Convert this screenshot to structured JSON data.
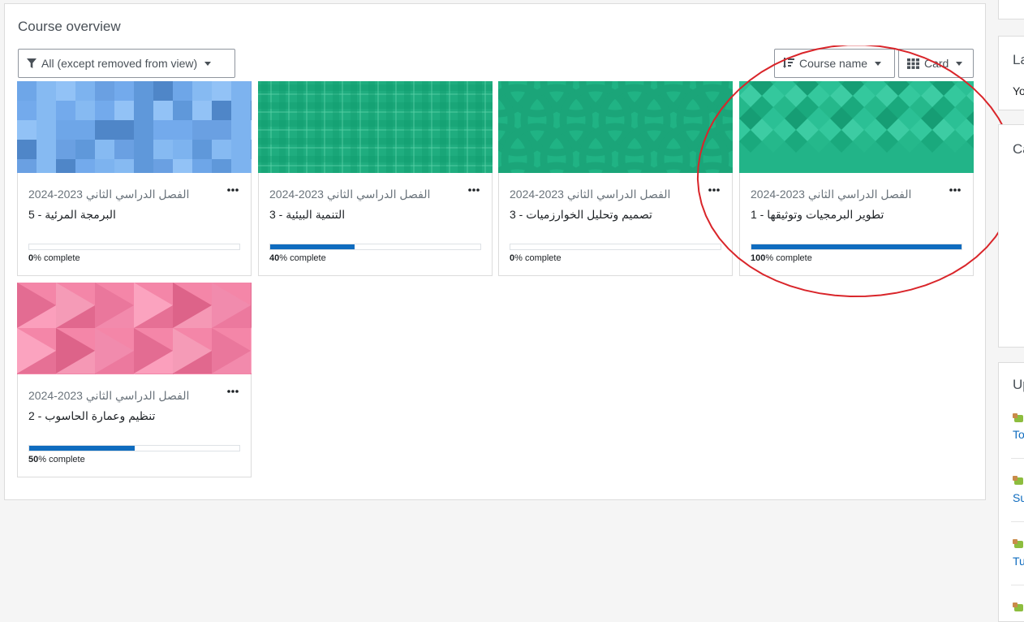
{
  "overview": {
    "title": "Course overview",
    "filter_label": "All (except removed from view)",
    "sort_label": "Course name",
    "view_label": "Card"
  },
  "courses": [
    {
      "category": "الفصل الدراسي الثاني 2023-2024",
      "name": "البرمجة المرئية - 5",
      "progress_pct": "0",
      "progress_suffix": "% complete",
      "progress": 0.0
    },
    {
      "category": "الفصل الدراسي الثاني 2023-2024",
      "name": "التنمية البيئية - 3",
      "progress_pct": "40",
      "progress_suffix": "% complete",
      "progress": 0.4
    },
    {
      "category": "الفصل الدراسي الثاني 2023-2024",
      "name": "تصميم وتحليل الخوارزميات - 3",
      "progress_pct": "0",
      "progress_suffix": "% complete",
      "progress": 0.0
    },
    {
      "category": "الفصل الدراسي الثاني 2023-2024",
      "name": "تطوير البرمجيات وتوثيقها - 1",
      "progress_pct": "100",
      "progress_suffix": "% complete",
      "progress": 1.0
    },
    {
      "category": "الفصل الدراسي الثاني 2023-2024",
      "name": "تنظيم وعمارة الحاسوب - 2",
      "progress_pct": "50",
      "progress_suffix": "% complete",
      "progress": 0.5
    }
  ],
  "sidebar": {
    "block1_title": "La",
    "block1_text": "Yo",
    "block2_title": "Ca",
    "block3_title": "Up",
    "block3_links": [
      "To",
      "Su",
      "Tu",
      ""
    ]
  },
  "colors": {
    "accent": "#0f6cbf",
    "annotation": "#d9252a"
  }
}
